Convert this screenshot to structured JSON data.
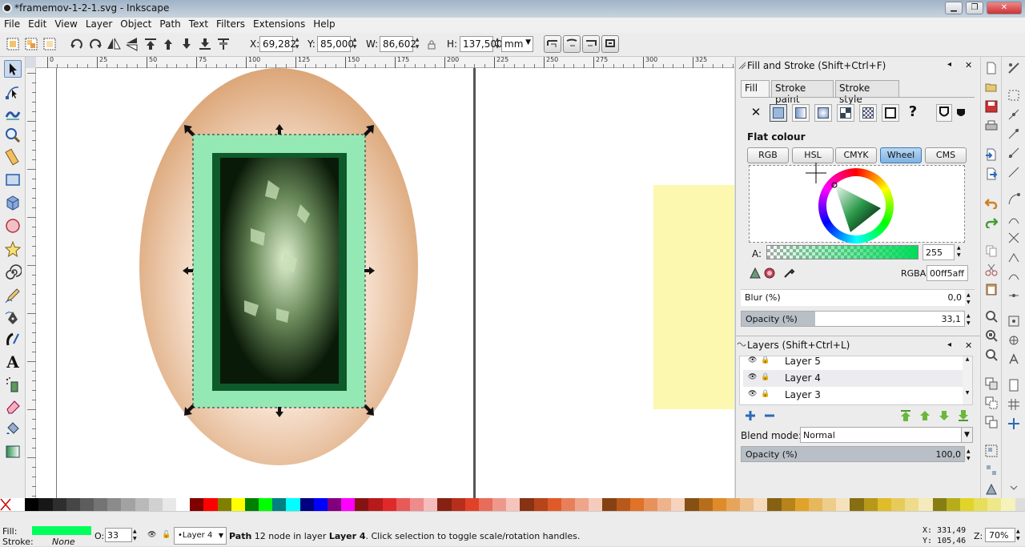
{
  "window": {
    "title": "*framemov-1-2-1.svg - Inkscape",
    "btn_min": "▁",
    "btn_max": "❐",
    "btn_close": "✕"
  },
  "menu": [
    "File",
    "Edit",
    "View",
    "Layer",
    "Object",
    "Path",
    "Text",
    "Filters",
    "Extensions",
    "Help"
  ],
  "toolctrl": {
    "x_label": "X:",
    "x_val": "69,282",
    "y_label": "Y:",
    "y_val": "85,000",
    "w_label": "W:",
    "w_val": "86,602",
    "h_label": "H:",
    "h_val": "137,500",
    "unit": "mm"
  },
  "ruler_ticks": [
    "0",
    "25",
    "50",
    "75",
    "100",
    "125",
    "150",
    "175",
    "200",
    "225",
    "250",
    "275",
    "300",
    "325"
  ],
  "fill_stroke": {
    "title": "Fill and Stroke (Shift+Ctrl+F)",
    "tabs": [
      "Fill",
      "Stroke paint",
      "Stroke style"
    ],
    "flat_colour": "Flat colour",
    "modes": [
      "RGB",
      "HSL",
      "CMYK",
      "Wheel",
      "CMS"
    ],
    "selected_mode": "Wheel",
    "alpha_label": "A:",
    "alpha_val": "255",
    "rgba_label": "RGBA:",
    "rgba_val": "00ff5aff",
    "blur_label": "Blur (%)",
    "blur_val": "0,0",
    "opacity_label": "Opacity (%)",
    "opacity_val": "33,1",
    "opacity_fraction": 0.331,
    "unknown_label": "?",
    "none_label": "✕"
  },
  "layers": {
    "title": "Layers (Shift+Ctrl+L)",
    "rows": [
      "Layer 5",
      "Layer 4",
      "Layer 3"
    ],
    "blend_label": "Blend mode:",
    "blend_val": "Normal",
    "opacity_label": "Opacity (%)",
    "opacity_val": "100,0",
    "opacity_fraction": 1.0
  },
  "colors": {
    "fill": "#00ff5a",
    "frame": "#94e8b4",
    "frame_dark": "#0e5a2b",
    "note": "#fdf8b0"
  },
  "status": {
    "fill_label": "Fill:",
    "stroke_label": "Stroke:",
    "stroke_val": "None",
    "o_label": "O:",
    "o_val": "33",
    "layer_val": "•Layer 4",
    "msg_bold": "Path",
    "msg_mid": " 12 node in layer ",
    "msg_layer": "Layer 4",
    "msg_end": ". Click selection to toggle scale/rotation handles.",
    "x_coord": "X:  331,49",
    "y_coord": "Y:  105,46",
    "z_label": "Z:",
    "zoom": "70%"
  }
}
